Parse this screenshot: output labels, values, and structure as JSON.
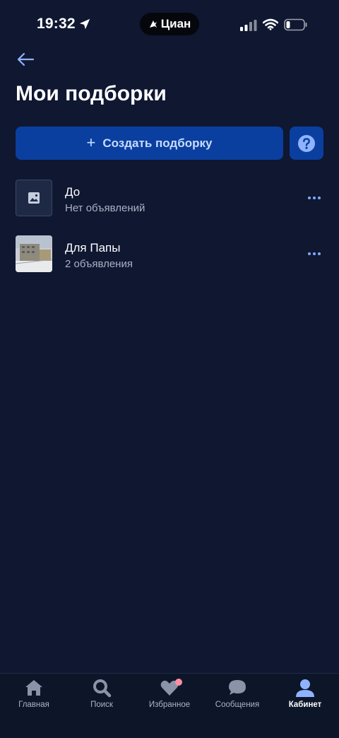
{
  "status_bar": {
    "time": "19:32",
    "island_label": "Циан",
    "icons": [
      "location-arrow-icon",
      "signal-icon",
      "wifi-icon",
      "battery-icon"
    ]
  },
  "header": {
    "back_icon": "arrow-left-icon",
    "title": "Мои подборки"
  },
  "actions": {
    "create_label": "Создать подборку",
    "create_icon": "plus-icon",
    "help_icon": "question-icon"
  },
  "collections": [
    {
      "title": "До",
      "subtitle": "Нет объявлений",
      "thumbnail": "image-placeholder-icon"
    },
    {
      "title": "Для Папы",
      "subtitle": "2 объявления",
      "thumbnail": "photo"
    }
  ],
  "tab_bar": {
    "tabs": [
      {
        "label": "Главная",
        "icon": "home-icon"
      },
      {
        "label": "Поиск",
        "icon": "search-icon"
      },
      {
        "label": "Избранное",
        "icon": "heart-icon"
      },
      {
        "label": "Сообщения",
        "icon": "chat-icon"
      },
      {
        "label": "Кабинет",
        "icon": "profile-icon"
      }
    ],
    "active": "Кабинет"
  },
  "colors": {
    "background": "#0f1731",
    "button": "#0a3fa0",
    "accent": "#7fa9ff",
    "badge": "#ff8fa0"
  }
}
